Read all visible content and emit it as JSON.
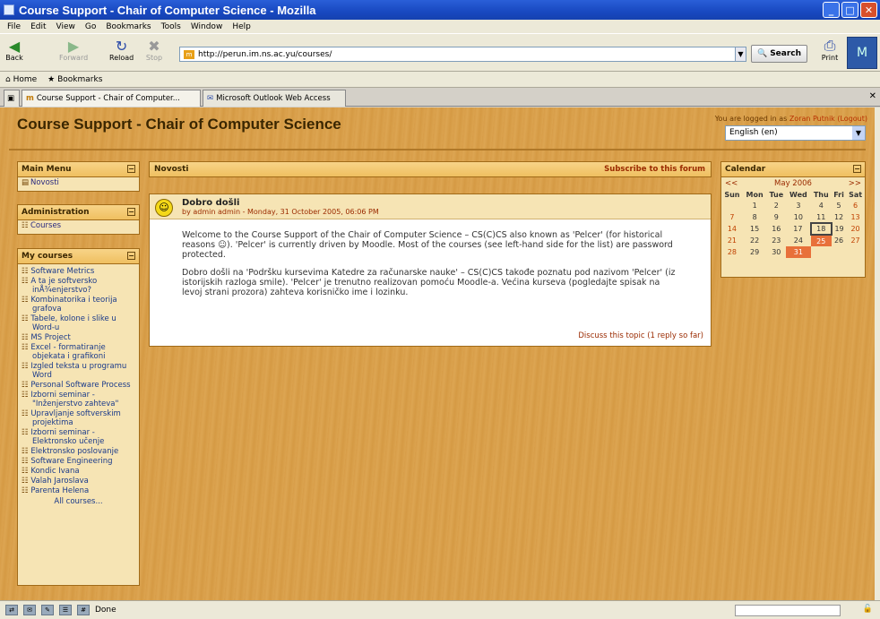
{
  "window": {
    "title": "Course Support - Chair of Computer Science - Mozilla"
  },
  "menu": [
    "File",
    "Edit",
    "View",
    "Go",
    "Bookmarks",
    "Tools",
    "Window",
    "Help"
  ],
  "nav": {
    "back": "Back",
    "forward": "Forward",
    "reload": "Reload",
    "stop": "Stop",
    "search": "Search",
    "print": "Print",
    "url": "http://perun.im.ns.ac.yu/courses/"
  },
  "personal": {
    "home": "Home",
    "bookmarks": "Bookmarks"
  },
  "tabs": [
    "Course Support - Chair of Computer...",
    "Microsoft Outlook Web Access"
  ],
  "site": {
    "title": "Course Support - Chair of Computer Science",
    "logged_prefix": "You are logged in as ",
    "user": "Zoran Putnik",
    "logout": "(Logout)",
    "language": "English (en)"
  },
  "main_menu": {
    "title": "Main Menu",
    "items": [
      "Novosti"
    ]
  },
  "admin": {
    "title": "Administration",
    "items": [
      "Courses"
    ]
  },
  "my_courses": {
    "title": "My courses",
    "items": [
      "Software Metrics",
      "A ta je softversko inÅ¾enjerstvo?",
      "Kombinatorika i teorija grafova",
      "Tabele, kolone i slike u Word-u",
      "MS Project",
      "Excel - formatiranje objekata i grafikoni",
      "Izgled teksta u programu Word",
      "Personal Software Process",
      "Izborni seminar - \"Inženjerstvo zahteva\"",
      "Upravljanje softverskim projektima",
      "Izborni seminar - Elektronsko učenje",
      "Elektronsko poslovanje",
      "Software Engineering",
      "Kondic Ivana",
      "Valah Jaroslava",
      "Parenta Helena"
    ],
    "all": "All courses..."
  },
  "forum": {
    "title": "Novosti",
    "subscribe": "Subscribe to this forum",
    "post": {
      "subject": "Dobro došli",
      "by": "by admin admin - Monday, 31 October 2005, 06:06 PM",
      "para1": "Welcome to the Course Support of the Chair of Computer Science – CS(C)CS also known as 'Pelcer' (for historical reasons ☺). 'Pelcer' is currently driven by Moodle. Most of the courses (see left-hand side for the list) are password protected.",
      "para2": "Dobro došli na 'Podršku kursevima Katedre za računarske nauke' – CS(C)CS takođe poznatu pod nazivom 'Pelcer' (iz istorijskih razloga smile). 'Pelcer' je trenutno realizovan pomoću Moodle-a. Većina kurseva (pogledajte spisak na levoj strani prozora) zahteva korisničko ime i lozinku.",
      "discuss": "Discuss this topic (1 reply so far)"
    }
  },
  "calendar": {
    "title": "Calendar",
    "prev": "<<",
    "next": ">>",
    "month": "May 2006",
    "days": [
      "Sun",
      "Mon",
      "Tue",
      "Wed",
      "Thu",
      "Fri",
      "Sat"
    ],
    "weeks": [
      [
        "",
        "1",
        "2",
        "3",
        "4",
        "5",
        "6"
      ],
      [
        "7",
        "8",
        "9",
        "10",
        "11",
        "12",
        "13"
      ],
      [
        "14",
        "15",
        "16",
        "17",
        "18",
        "19",
        "20"
      ],
      [
        "21",
        "22",
        "23",
        "24",
        "25",
        "26",
        "27"
      ],
      [
        "28",
        "29",
        "30",
        "31",
        "",
        "",
        ""
      ]
    ],
    "today": "18",
    "highlighted": [
      "25",
      "31"
    ]
  },
  "status": {
    "text": "Done"
  }
}
